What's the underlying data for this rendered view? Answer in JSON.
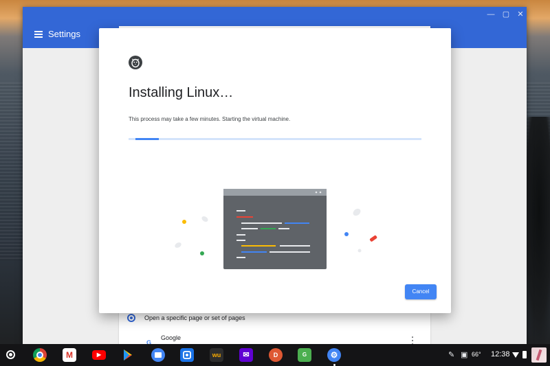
{
  "window": {
    "app_title": "Settings",
    "controls": {
      "minimize": "—",
      "maximize": "▢",
      "close": "✕"
    }
  },
  "background_settings": {
    "radio_label": "Open a specific page or set of pages",
    "page_name": "Google",
    "page_icon_text": "G"
  },
  "dialog": {
    "icon": "linux-penguin-icon",
    "title": "Installing Linux…",
    "message": "This process may take a few minutes. Starting the virtual machine.",
    "progress_fraction": 0.08,
    "cancel_label": "Cancel"
  },
  "colors": {
    "accent": "#3367d6",
    "button": "#4285f4",
    "progress_track": "#d3e3fb"
  },
  "shelf": {
    "apps": [
      {
        "name": "chrome",
        "label": ""
      },
      {
        "name": "gmail",
        "label": "M"
      },
      {
        "name": "youtube",
        "label": "▶"
      },
      {
        "name": "play-store",
        "label": ""
      },
      {
        "name": "files",
        "label": ""
      },
      {
        "name": "app-blue",
        "label": ""
      },
      {
        "name": "weather-underground",
        "label": "wu"
      },
      {
        "name": "yahoo-mail",
        "label": "✉"
      },
      {
        "name": "duckduckgo",
        "label": "D"
      },
      {
        "name": "google-translate",
        "label": "G"
      },
      {
        "name": "settings",
        "label": "⚙"
      }
    ],
    "tray": {
      "temperature": "66°",
      "time": "12:38"
    }
  }
}
